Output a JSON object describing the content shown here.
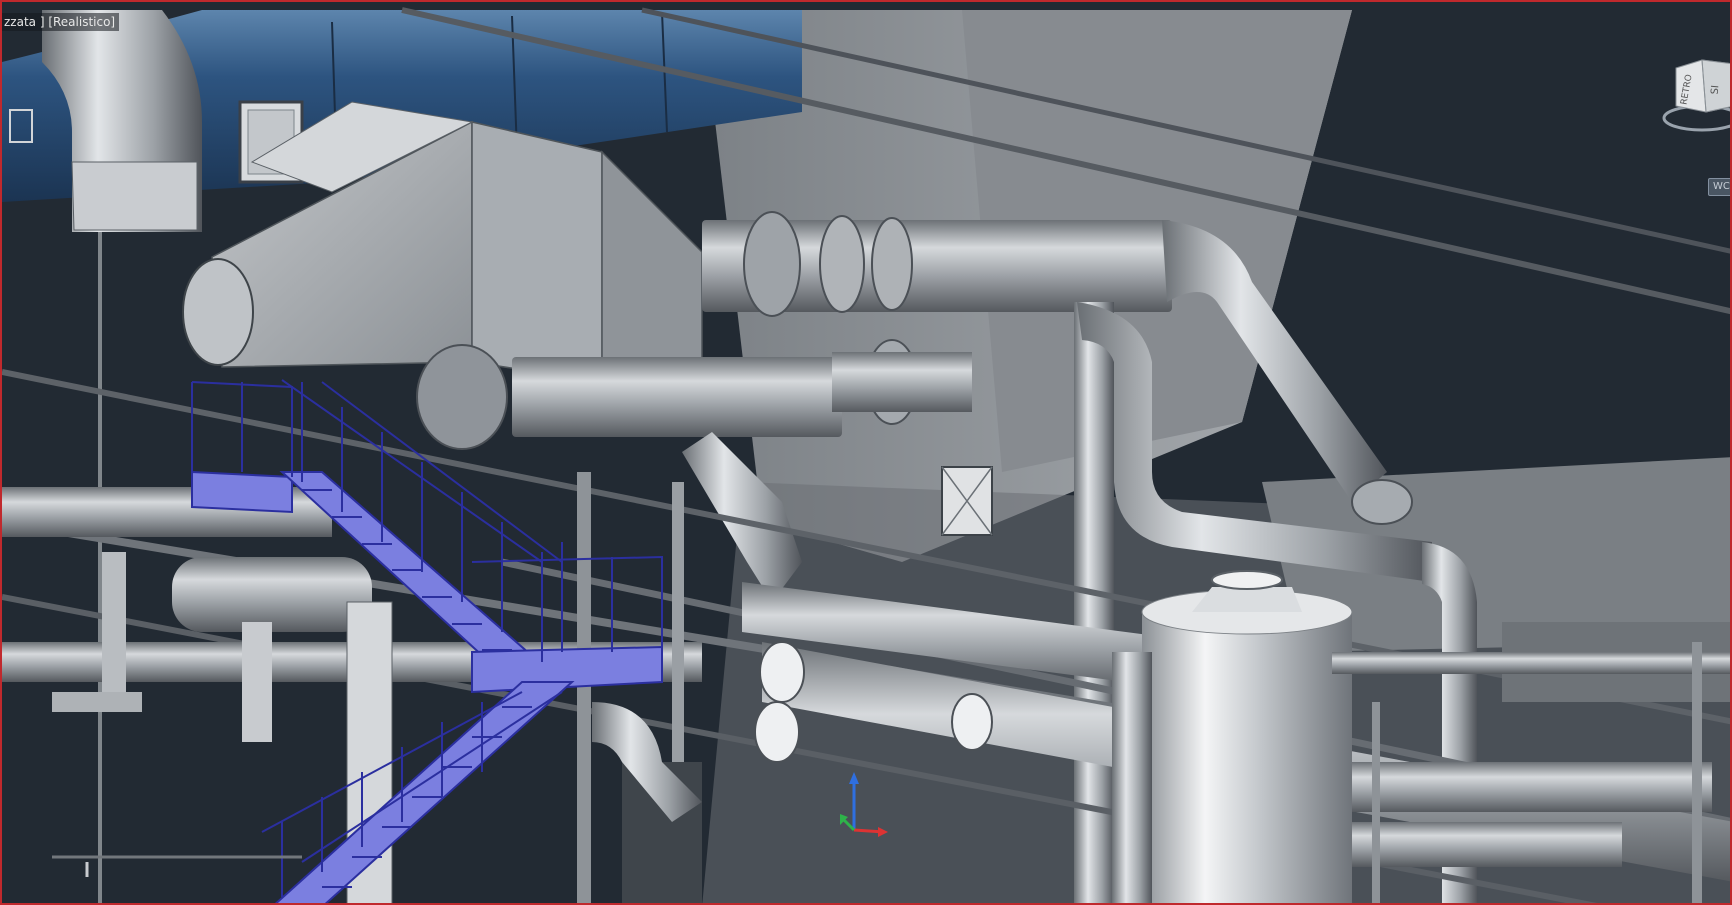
{
  "viewport": {
    "label": "zzata ] [Realistico]",
    "active_border_color": "#c0292d",
    "background_color": "#222a33"
  },
  "viewcube": {
    "front_face": "RETRO",
    "side_face": "SI"
  },
  "wcs": {
    "label": "WCS"
  },
  "colors": {
    "duct_blue": "#2a4d73",
    "steel_gray": "#9aa0a6",
    "stair_blue": "#3437b8",
    "stair_tread": "#7b7fe0"
  },
  "icons": {
    "ucs": "ucs-axis-icon",
    "viewcube": "viewcube-icon"
  }
}
